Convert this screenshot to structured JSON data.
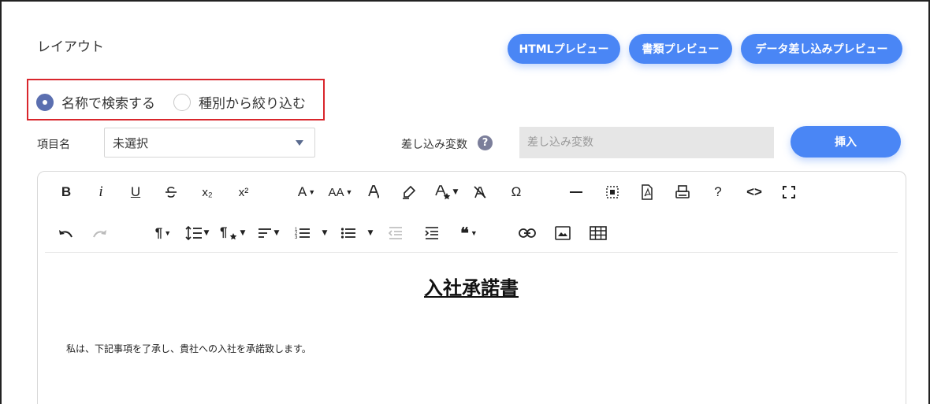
{
  "section": {
    "title": "レイアウト"
  },
  "top_buttons": {
    "html_preview": "HTMLプレビュー",
    "doc_preview": "書類プレビュー",
    "merge_preview": "データ差し込みプレビュー"
  },
  "search_mode": {
    "options": [
      {
        "label": "名称で検索する",
        "selected": true
      },
      {
        "label": "種別から絞り込む",
        "selected": false
      }
    ]
  },
  "item_field": {
    "label": "項目名",
    "value": "未選択"
  },
  "merge_var": {
    "label": "差し込み変数",
    "help": "?",
    "placeholder": "差し込み変数",
    "insert_label": "挿入"
  },
  "toolbar": {
    "bold": "B",
    "italic": "i",
    "underline": "U",
    "subscript": "x₂",
    "superscript": "x²",
    "font_color": "A",
    "font_size": "AA",
    "omega": "Ω",
    "help": "?",
    "code": "<>",
    "paragraph": "¶",
    "quote": "66"
  },
  "document": {
    "title": "入社承諾書",
    "body": "私は、下記事項を了承し、貴社への入社を承諾致します。"
  },
  "colors": {
    "accent": "#4a86f5",
    "highlight_border": "#d9262c",
    "radio_on": "#5b6fb0"
  }
}
